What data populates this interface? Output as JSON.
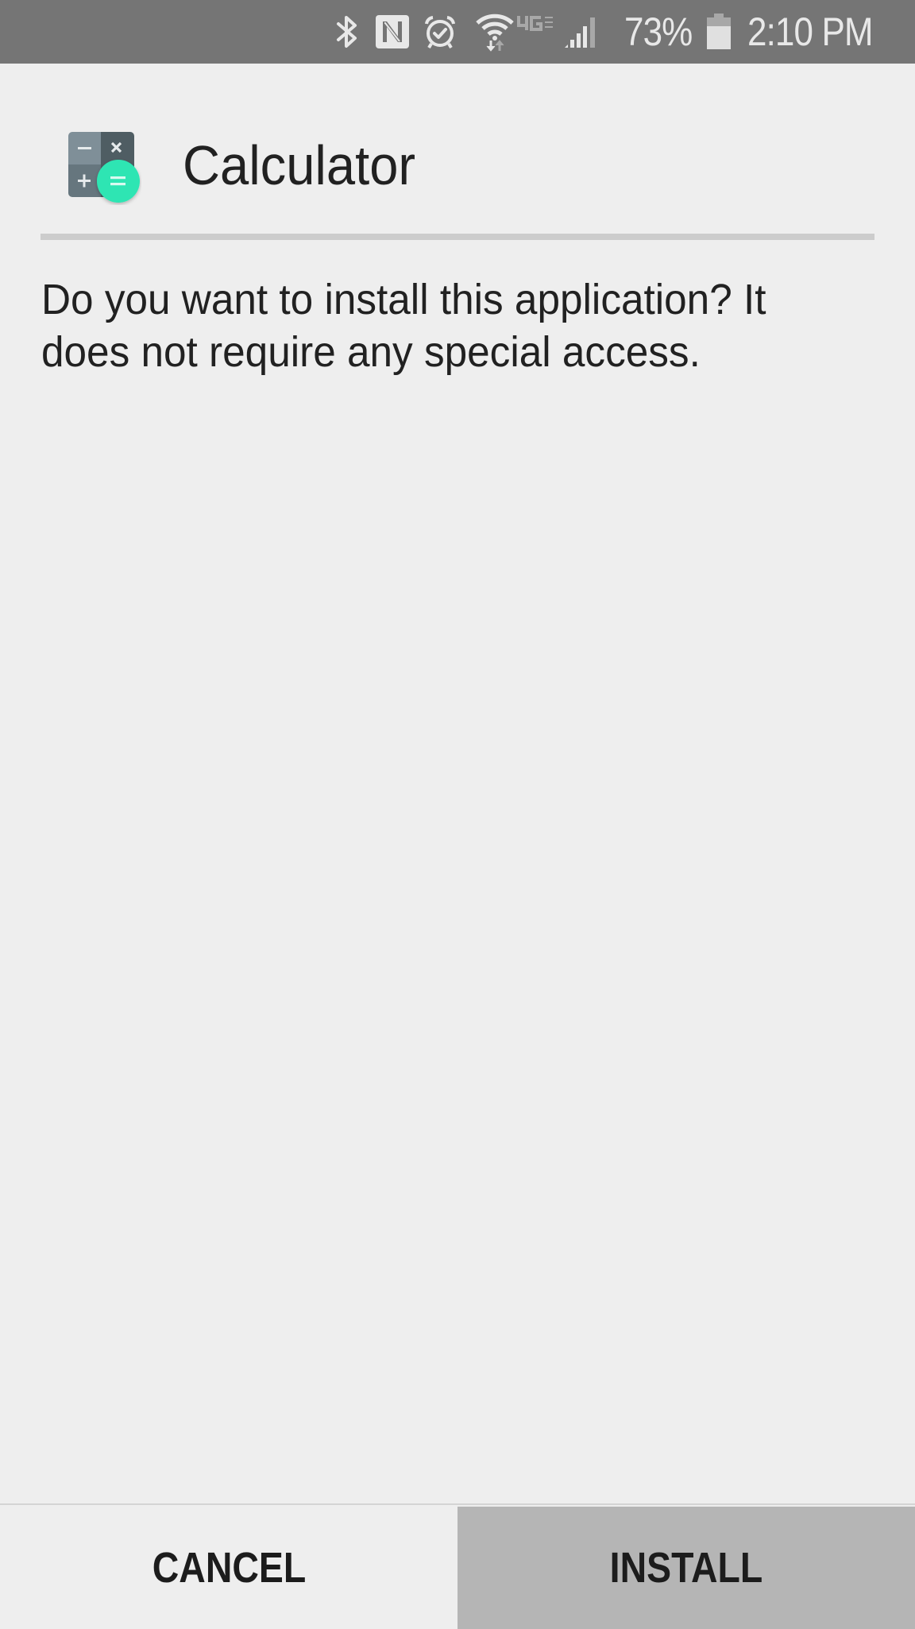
{
  "status_bar": {
    "icons": [
      {
        "name": "bluetooth-icon"
      },
      {
        "name": "nfc-icon"
      },
      {
        "name": "alarm-icon"
      },
      {
        "name": "wifi-icon"
      },
      {
        "name": "network-4g-icon",
        "label": "4G"
      },
      {
        "name": "signal-strength-icon"
      },
      {
        "name": "battery-icon"
      }
    ],
    "network_type": "4G",
    "battery_percent": "73%",
    "battery_level": 0.73,
    "time": "2:10 PM",
    "background_color": "#757575"
  },
  "app": {
    "name": "Calculator",
    "icon": "calculator-app-icon",
    "icon_colors": {
      "tile_light": "#7f8f98",
      "tile_dark": "#4f5d64",
      "equals_circle": "#2ee5b3"
    }
  },
  "message": {
    "lines": [
      "Do you want to install this application? It",
      "does not require any special access."
    ],
    "full_text": "Do you want to install this application? It does not require any special access."
  },
  "actions": {
    "cancel_label": "CANCEL",
    "install_label": "INSTALL",
    "install_background": "#b5b5b5"
  }
}
